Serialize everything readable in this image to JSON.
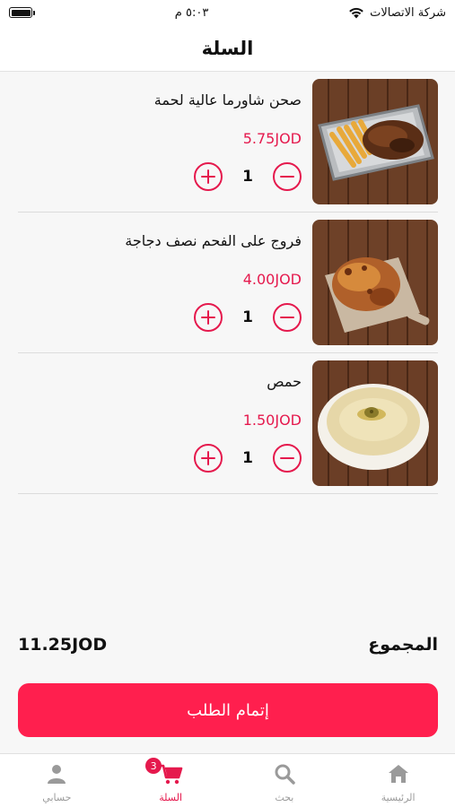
{
  "status_bar": {
    "carrier": "شركة الاتصالات",
    "time": "٥:٠٣ م",
    "battery_level": 1.0
  },
  "header": {
    "title": "السلة"
  },
  "cart": {
    "items": [
      {
        "name": "صحن شاورما عالية لحمة",
        "price": "5.75JOD",
        "quantity": "1",
        "image_icon": "shawarma-plate-photo"
      },
      {
        "name": "فروج على الفحم نصف دجاجة",
        "price": "4.00JOD",
        "quantity": "1",
        "image_icon": "grilled-chicken-photo"
      },
      {
        "name": "حمص",
        "price": "1.50JOD",
        "quantity": "1",
        "image_icon": "hummus-bowl-photo"
      }
    ]
  },
  "summary": {
    "total_label": "المجموع",
    "total_amount": "11.25JOD"
  },
  "checkout": {
    "label": "إتمام الطلب"
  },
  "tab_bar": {
    "items": [
      {
        "label": "الرئيسية",
        "icon": "home-icon"
      },
      {
        "label": "بحث",
        "icon": "search-icon"
      },
      {
        "label": "السلة",
        "icon": "cart-icon",
        "badge": "3",
        "active": true
      },
      {
        "label": "حسابي",
        "icon": "person-icon"
      }
    ]
  },
  "colors": {
    "accent": "#e5194d",
    "button": "#ff1f4e",
    "inactive_tab": "#9a9a9a",
    "background": "#f7f7f7"
  }
}
